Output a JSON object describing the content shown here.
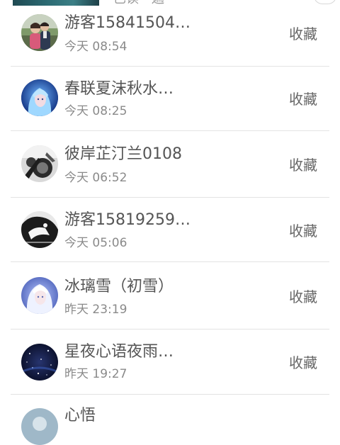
{
  "top_partial": {
    "text": "已读一遍"
  },
  "items": [
    {
      "name": "游客15841504…",
      "time": "今天 08:54",
      "action": "收藏",
      "avatar": "couple-photo-avatar"
    },
    {
      "name": "春联夏沫秋水…",
      "time": "今天 08:25",
      "action": "收藏",
      "avatar": "anime-blue-hair-avatar"
    },
    {
      "name": "彼岸芷汀兰0108",
      "time": "今天 06:52",
      "action": "收藏",
      "avatar": "monochrome-sketch-avatar"
    },
    {
      "name": "游客15819259…",
      "time": "今天 05:06",
      "action": "收藏",
      "avatar": "monochrome-cartoon-avatar"
    },
    {
      "name": "冰璃雪（初雪）",
      "time": "昨天 23:19",
      "action": "收藏",
      "avatar": "anime-white-hair-avatar"
    },
    {
      "name": "星夜心语夜雨…",
      "time": "昨天 19:27",
      "action": "收藏",
      "avatar": "night-sky-avatar"
    },
    {
      "name": "心悟",
      "time": "",
      "action": "",
      "avatar": "partial-avatar"
    }
  ]
}
